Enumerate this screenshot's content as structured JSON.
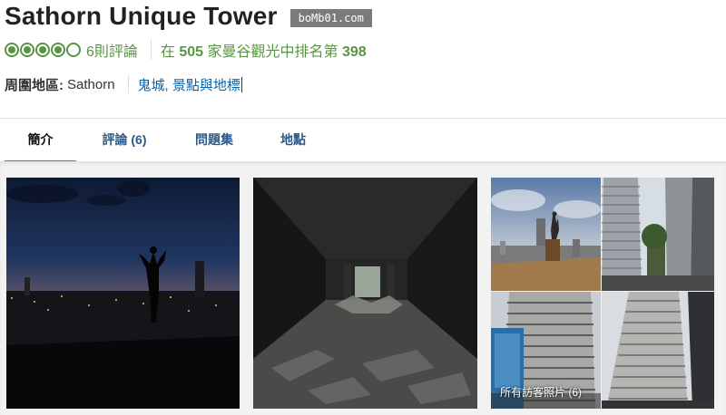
{
  "header": {
    "title": "Sathorn Unique Tower",
    "watermark": "boMb01.com"
  },
  "rating": {
    "bubbles_filled": 4,
    "bubbles_total": 5,
    "review_count": "6則評論",
    "rank_prefix": "在",
    "rank_total": "505",
    "rank_middle": "家曼谷觀光中排名第",
    "rank_position": "398"
  },
  "location": {
    "label": "周圍地區:",
    "area": "Sathorn",
    "categories": "鬼城, 景點與地標"
  },
  "tabs": [
    {
      "label": "簡介",
      "active": true
    },
    {
      "label": "評論 (6)",
      "active": false
    },
    {
      "label": "問題集",
      "active": false
    },
    {
      "label": "地點",
      "active": false
    }
  ],
  "gallery": {
    "all_photos_label": "所有訪客照片 (6)"
  },
  "colors": {
    "brand_green": "#589442",
    "link_blue": "#0b63a6"
  }
}
